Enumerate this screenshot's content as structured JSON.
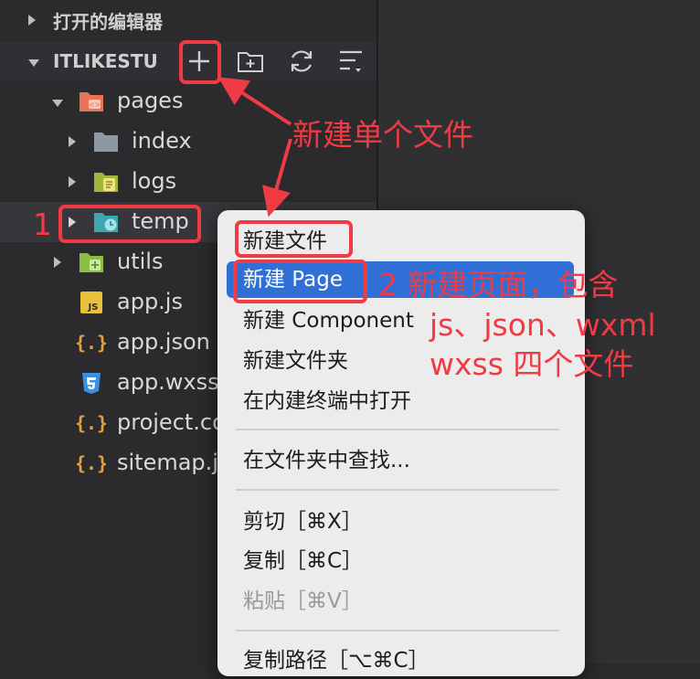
{
  "sidebar": {
    "open_editors_title": "打开的编辑器",
    "project_name": "ITLIKESTU",
    "toolbar_icons": [
      "new-file-icon",
      "new-folder-icon",
      "refresh-icon",
      "collapse-all-icon"
    ],
    "tree": [
      {
        "label": "pages",
        "icon": "pages-folder-icon"
      },
      {
        "label": "index",
        "icon": "folder-icon"
      },
      {
        "label": "logs",
        "icon": "logs-folder-icon"
      },
      {
        "label": "temp",
        "icon": "temp-folder-icon"
      },
      {
        "label": "utils",
        "icon": "utils-folder-icon"
      },
      {
        "label": "app.js",
        "icon": "js-file-icon"
      },
      {
        "label": "app.json",
        "icon": "json-file-icon"
      },
      {
        "label": "app.wxss",
        "icon": "wxss-file-icon"
      },
      {
        "label": "project.co",
        "icon": "json-file-icon"
      },
      {
        "label": "sitemap.js",
        "icon": "json-file-icon"
      }
    ]
  },
  "context_menu": {
    "items": [
      "新建文件",
      "新建 Page",
      "新建 Component",
      "新建文件夹",
      "在内建终端中打开",
      "在文件夹中查找...",
      "剪切［⌘X］",
      "复制［⌘C］",
      "粘贴［⌘V］",
      "复制路径［⌥⌘C］"
    ]
  },
  "annotations": {
    "new_single_file": "新建单个文件",
    "step1": "1",
    "step2_line1": "2 新建页面，包含",
    "step2_line2": "js、json、wxml",
    "step2_line3": "wxss 四个文件"
  },
  "colors": {
    "annotation_red": "#f03a44",
    "menu_highlight": "#2f6fd6",
    "folder_teal": "#3fa7b0",
    "folder_gray": "#8c98a4",
    "folder_orange": "#e8735a",
    "folder_green": "#8bbf3e",
    "js_yellow": "#e8c13c",
    "json_orange": "#e9a23b",
    "wxss_blue": "#3d8fe0"
  }
}
